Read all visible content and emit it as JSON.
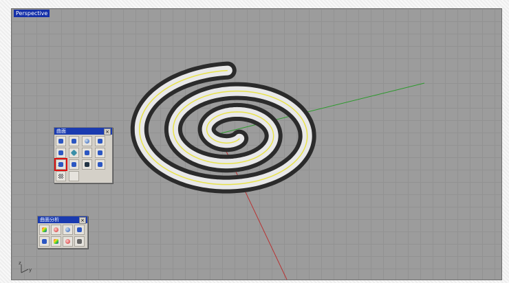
{
  "viewport": {
    "title": "Perspective",
    "axis_labels": {
      "z": "z",
      "y": "y"
    }
  },
  "toolbars": {
    "surface": {
      "title": "曲面",
      "close": "×",
      "tools": [
        {
          "icon": "surface-from-points-icon",
          "style": "t-blue"
        },
        {
          "icon": "surface-box-icon",
          "style": "t-blue"
        },
        {
          "icon": "sphere-icon",
          "style": "t-sphere"
        },
        {
          "icon": "edge-surface-icon",
          "style": "t-blue"
        },
        {
          "icon": "sweep-icon",
          "style": "t-blue"
        },
        {
          "icon": "extrude-icon",
          "style": "t-teal"
        },
        {
          "icon": "loft-icon",
          "style": "t-blue"
        },
        {
          "icon": "revolve-icon",
          "style": "t-blue"
        },
        {
          "icon": "sweep-two-rails-icon",
          "style": "t-blue",
          "highlight": true,
          "label": "2"
        },
        {
          "icon": "patch-icon",
          "style": "t-blue"
        },
        {
          "icon": "rail-revolve-icon",
          "style": "t-dark"
        },
        {
          "icon": "network-surface-icon",
          "style": "t-blue"
        },
        {
          "icon": "plane-grid-icon",
          "style": "t-check"
        },
        {
          "icon": "empty-slot",
          "style": "t-empty"
        }
      ]
    },
    "surface_analysis": {
      "title": "曲面分析",
      "close": "×",
      "tools": [
        {
          "icon": "zebra-analysis-icon",
          "style": "t-rainbow"
        },
        {
          "icon": "curvature-analysis-icon",
          "style": "t-red"
        },
        {
          "icon": "environment-map-icon",
          "style": "t-sphere"
        },
        {
          "icon": "draft-angle-icon",
          "style": "t-blue"
        },
        {
          "icon": "direction-icon",
          "style": "t-blue"
        },
        {
          "icon": "emap-icon",
          "style": "t-rainbow"
        },
        {
          "icon": "edge-analysis-icon",
          "style": "t-red"
        },
        {
          "icon": "gumball-icon",
          "style": "t-gray"
        }
      ]
    }
  }
}
